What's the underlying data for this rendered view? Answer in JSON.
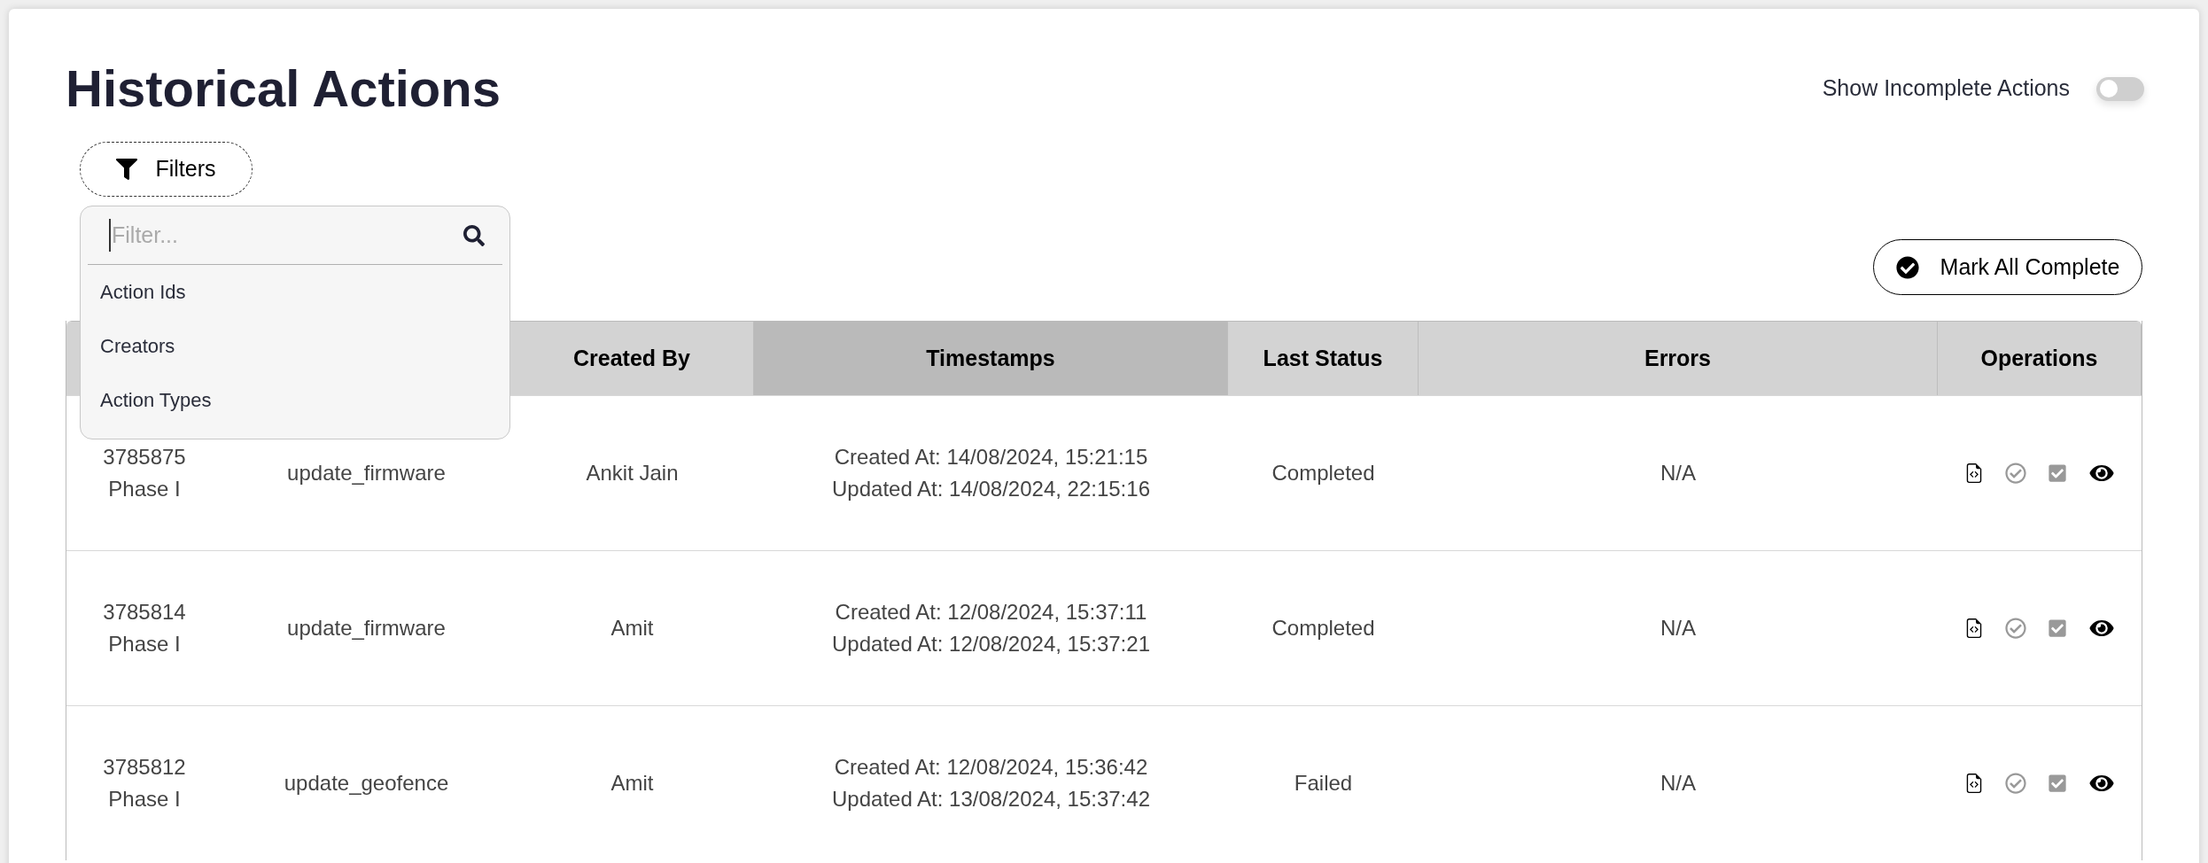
{
  "title": "Historical Actions",
  "incomplete_toggle": {
    "label": "Show Incomplete Actions",
    "on": false
  },
  "filters": {
    "button": "Filters",
    "search": {
      "placeholder": "Filter..."
    },
    "options": [
      "Action Ids",
      "Creators",
      "Action Types"
    ]
  },
  "mark_all_button": "Mark All Complete",
  "table": {
    "columns": [
      {
        "label": "Created By",
        "highlighted": false
      },
      {
        "label": "Timestamps",
        "highlighted": true
      },
      {
        "label": "Last Status",
        "highlighted": false
      },
      {
        "label": "Errors",
        "highlighted": false
      },
      {
        "label": "Operations",
        "highlighted": false
      }
    ],
    "rows": [
      {
        "id": "3785875",
        "phase": "Phase I",
        "type": "update_firmware",
        "creator": "Ankit Jain",
        "created": "Created At: 14/08/2024, 15:21:15",
        "updated": "Updated At: 14/08/2024, 22:15:16",
        "status": "Completed",
        "errors": "N/A"
      },
      {
        "id": "3785814",
        "phase": "Phase I",
        "type": "update_firmware",
        "creator": "Amit",
        "created": "Created At: 12/08/2024, 15:37:11",
        "updated": "Updated At: 12/08/2024, 15:37:21",
        "status": "Completed",
        "errors": "N/A"
      },
      {
        "id": "3785812",
        "phase": "Phase I",
        "type": "update_geofence",
        "creator": "Amit",
        "created": "Created At: 12/08/2024, 15:36:42",
        "updated": "Updated At: 13/08/2024, 15:37:42",
        "status": "Failed",
        "errors": "N/A"
      }
    ]
  }
}
